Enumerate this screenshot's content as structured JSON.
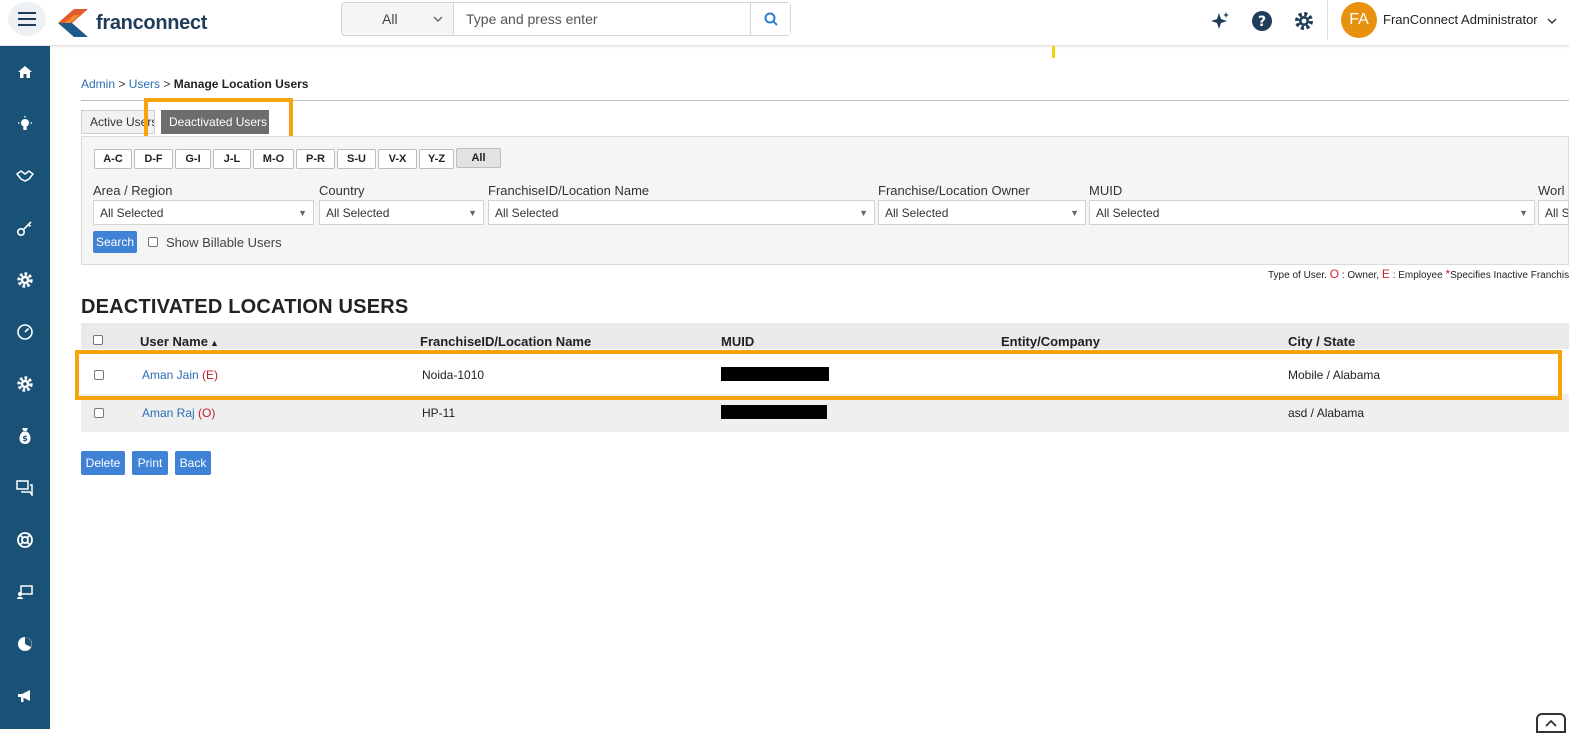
{
  "header": {
    "logo_text": "franconnect",
    "search_category": "All",
    "search_placeholder": "Type and press enter",
    "user_initials": "FA",
    "user_name": "FranConnect Administrator"
  },
  "breadcrumb": {
    "admin": "Admin",
    "users": "Users",
    "sep": ">",
    "current": "Manage Location Users"
  },
  "tabs": {
    "active_users": "Active Users",
    "deactivated_users": "Deactivated Users"
  },
  "alpha_filters": [
    "A-C",
    "D-F",
    "G-I",
    "J-L",
    "M-O",
    "P-R",
    "S-U",
    "V-X",
    "Y-Z",
    "All"
  ],
  "filters": [
    {
      "label": "Area / Region",
      "value": "All Selected"
    },
    {
      "label": "Country",
      "value": "All Selected"
    },
    {
      "label": "FranchiseID/Location Name",
      "value": "All Selected"
    },
    {
      "label": "Franchise/Location Owner",
      "value": "All Selected"
    },
    {
      "label": "MUID",
      "value": "All Selected"
    },
    {
      "label": "Worl",
      "value": "All S"
    }
  ],
  "search_button": "Search",
  "show_billable": "Show Billable Users",
  "legend": {
    "prefix": "Type of User.",
    "o": "O",
    "owner": ": Owner,",
    "e": "E",
    "employee": ": Employee",
    "star": "*",
    "inactive": "Specifies Inactive Franchis"
  },
  "section_title": "DEACTIVATED LOCATION USERS",
  "table": {
    "columns": [
      "User Name",
      "FranchiseID/Location Name",
      "MUID",
      "Entity/Company",
      "City / State"
    ],
    "sort_indicator": "▲",
    "rows": [
      {
        "name": "Aman Jain",
        "type": "(E)",
        "location": "Noida-1010",
        "muid": "",
        "entity": "",
        "city_state": "Mobile / Alabama"
      },
      {
        "name": "Aman Raj",
        "type": "(O)",
        "location": "HP-11",
        "muid": "",
        "entity": "",
        "city_state": "asd / Alabama"
      }
    ]
  },
  "actions": {
    "delete": "Delete",
    "print": "Print",
    "back": "Back"
  },
  "colors": {
    "sidebar": "#1a5177",
    "highlight": "#f5a40c",
    "accent_blue": "#3f82d6",
    "avatar": "#e8910f"
  }
}
